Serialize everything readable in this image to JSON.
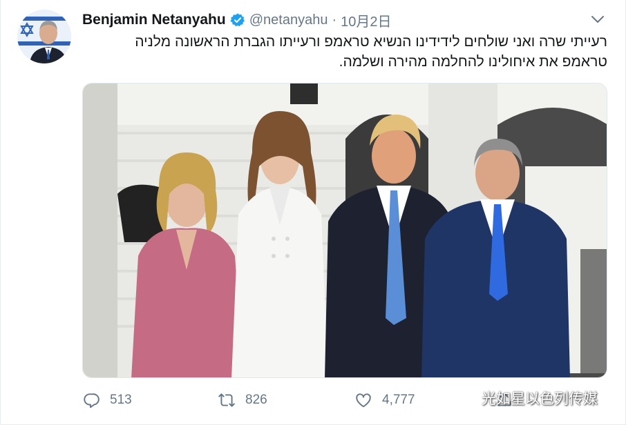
{
  "author": {
    "name": "Benjamin Netanyahu",
    "handle": "@netanyahu",
    "separator": "·",
    "date": "10月2日",
    "verified": true
  },
  "tweet": {
    "text_line1": "רעייתי שרה ואני שולחים לידידינו הנשיא טראמפ ורעייתו הגברת הראשונה מלניה",
    "text_line2": "טראמפ את איחולינו להחלמה מהירה ושלמה."
  },
  "stats": {
    "replies": "513",
    "retweets": "826",
    "likes": "4,777"
  },
  "watermark": {
    "text": "光如星以色列传媒"
  },
  "colors": {
    "verified_blue": "#1da1f2",
    "muted_text": "#657786",
    "border": "#e6ecf0"
  }
}
